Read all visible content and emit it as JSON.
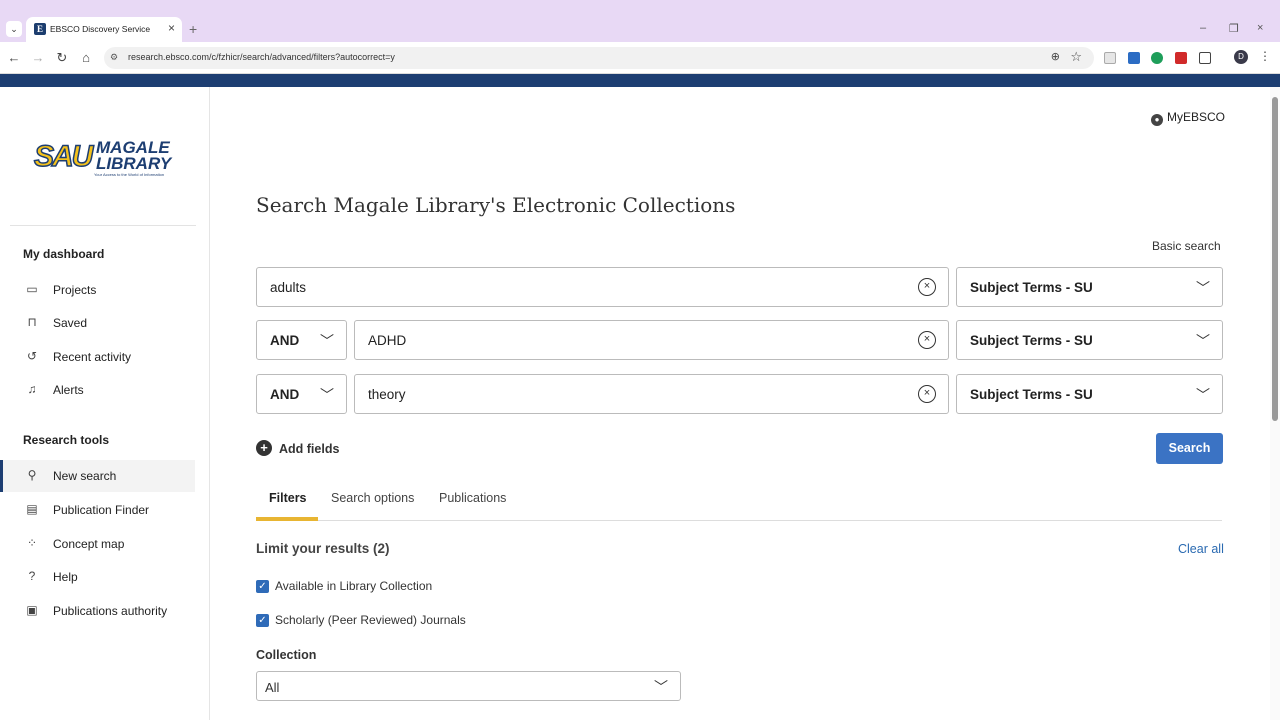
{
  "browser": {
    "tab_title": "EBSCO Discovery Service",
    "tab_favicon": "E",
    "url": "research.ebsco.com/c/fzhicr/search/advanced/filters?autocorrect=y",
    "profile_initial": "D"
  },
  "sidebar": {
    "logo": {
      "sau": "SAU",
      "line1": "MAGALE",
      "line2": "LIBRARY",
      "tagline": "Your Access to the World of Information"
    },
    "dashboard_heading": "My dashboard",
    "dashboard_items": [
      {
        "label": "Projects",
        "icon": "folder-icon"
      },
      {
        "label": "Saved",
        "icon": "bookmark-icon"
      },
      {
        "label": "Recent activity",
        "icon": "history-icon"
      },
      {
        "label": "Alerts",
        "icon": "bell-icon"
      }
    ],
    "tools_heading": "Research tools",
    "tools_items": [
      {
        "label": "New search",
        "icon": "search-icon",
        "active": true
      },
      {
        "label": "Publication Finder",
        "icon": "document-icon"
      },
      {
        "label": "Concept map",
        "icon": "concept-map-icon"
      },
      {
        "label": "Help",
        "icon": "help-icon"
      },
      {
        "label": "Publications authority",
        "icon": "authority-icon"
      }
    ]
  },
  "header": {
    "myebsco": "MyEBSCO"
  },
  "main": {
    "title": "Search Magale Library's Electronic Collections",
    "basic_search": "Basic search",
    "rows": [
      {
        "operator": null,
        "term": "adults",
        "field": "Subject Terms - SU"
      },
      {
        "operator": "AND",
        "term": "ADHD",
        "field": "Subject Terms - SU"
      },
      {
        "operator": "AND",
        "term": "theory",
        "field": "Subject Terms - SU"
      }
    ],
    "add_fields": "Add fields",
    "search_button": "Search",
    "tabs": [
      {
        "label": "Filters",
        "selected": true
      },
      {
        "label": "Search options",
        "selected": false
      },
      {
        "label": "Publications",
        "selected": false
      }
    ],
    "limit_title": "Limit your results (2)",
    "clear_all": "Clear all",
    "limits": [
      {
        "label": "Available in Library Collection",
        "checked": true
      },
      {
        "label": "Scholarly (Peer Reviewed) Journals",
        "checked": true
      }
    ],
    "collection_label": "Collection",
    "collection_value": "All"
  },
  "colors": {
    "brand_navy": "#1d3e72",
    "accent_gold": "#e8b532",
    "button_blue": "#3b73c4",
    "link_blue": "#2a6ab1"
  }
}
